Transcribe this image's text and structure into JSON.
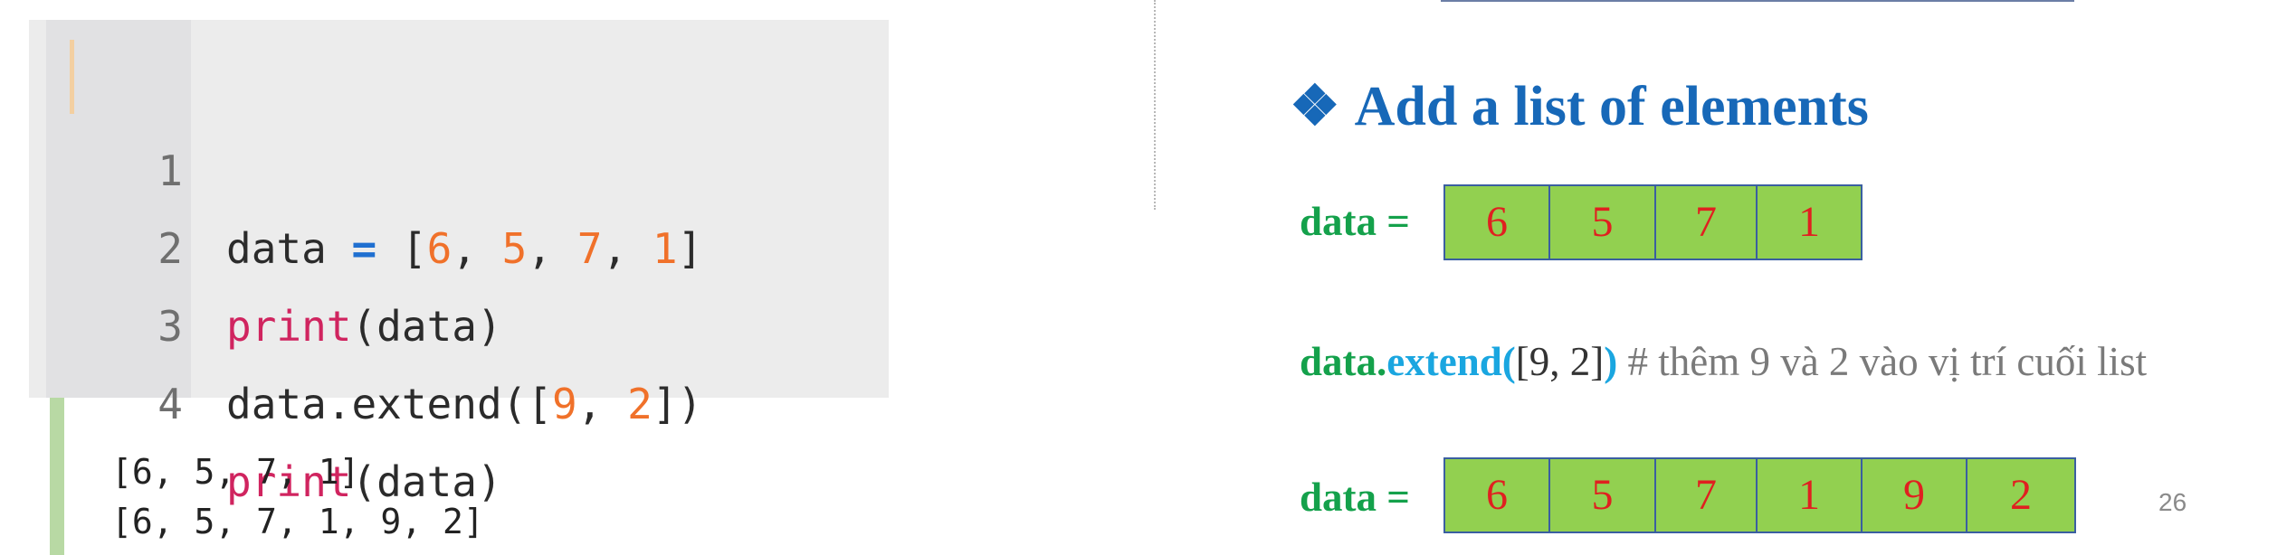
{
  "code": {
    "lines": [
      {
        "number": "1",
        "parts": [
          "data ",
          "=",
          " [",
          "6",
          ", ",
          "5",
          ", ",
          "7",
          ", ",
          "1",
          "]"
        ]
      },
      {
        "number": "2",
        "parts": [
          "print",
          "(data)"
        ]
      },
      {
        "number": "3",
        "parts": [
          "data.extend([",
          "9",
          ", ",
          "2",
          "])"
        ]
      },
      {
        "number": "4",
        "parts": [
          "print",
          "(data)"
        ]
      }
    ]
  },
  "output": {
    "lines": [
      "[6, 5, 7, 1]",
      "[6, 5, 7, 1, 9, 2]"
    ]
  },
  "slide": {
    "bullet": "❖",
    "heading": "Add a list of elements",
    "label_before": "data =",
    "list_before": [
      "6",
      "5",
      "7",
      "1"
    ],
    "extend_obj": "data.",
    "extend_method": "extend(",
    "extend_args": "[9, 2]",
    "extend_close": ")",
    "extend_comment": " # thêm 9 và 2 vào vị trí cuối list",
    "label_after": "data =",
    "list_after": [
      "6",
      "5",
      "7",
      "1",
      "9",
      "2"
    ],
    "page_number": "26"
  },
  "colors": {
    "heading": "#1768b8",
    "label_green": "#14a14b",
    "cell_fill": "#92d050",
    "cell_text": "#e02020",
    "keyword_print": "#d0245f",
    "number_literal": "#f0712a"
  }
}
